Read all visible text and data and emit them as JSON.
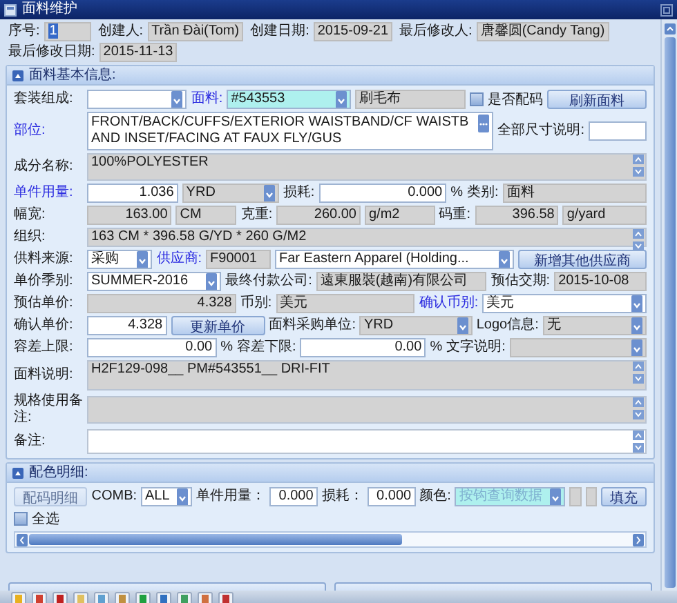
{
  "window": {
    "title": "面料维护"
  },
  "header_fields": [
    {
      "label": "序号:",
      "value": "1",
      "text_selected": true
    },
    {
      "label": "创建人:",
      "value": "Trần Đài(Tom)",
      "text_selected": false
    },
    {
      "label": "创建日期:",
      "value": "2015-09-21",
      "text_selected": false
    },
    {
      "label": "最后修改人:",
      "value": "唐馨圆(Candy Tang)",
      "text_selected": false
    },
    {
      "label": "最后修改日期:",
      "value": "2015-11-13",
      "text_selected": false
    }
  ],
  "basic_info": {
    "title": "面料基本信息:",
    "expanded": true,
    "rows": [
      {
        "items": [
          {
            "kind": "label",
            "text": "套装组成:",
            "required": false
          },
          {
            "kind": "dropdown",
            "readonly": false,
            "highlighted": false
          },
          {
            "kind": "label",
            "text": "面料:",
            "required": true
          },
          {
            "kind": "dropdown",
            "value": "#543553",
            "readonly": false,
            "highlighted": true
          },
          {
            "kind": "field",
            "value": "刷毛布",
            "readonly": true,
            "highlighted": false
          },
          {
            "kind": "checkbox",
            "text": "是否配码",
            "checked": false
          },
          {
            "kind": "button",
            "text": "刷新面料",
            "disabled": false
          }
        ]
      },
      {
        "items": [
          {
            "kind": "label",
            "text": "部位:",
            "required": true
          },
          {
            "kind": "browse",
            "value": "FRONT/BACK/CUFFS/EXTERIOR WAISTBAND/CF WAISTBAND INSET/FACING AT FAUX FLY/GUS",
            "readonly": false,
            "highlighted": false
          },
          {
            "kind": "label",
            "text": "全部尺寸说明:",
            "required": false
          },
          {
            "kind": "field",
            "readonly": false,
            "highlighted": false
          }
        ]
      },
      {
        "items": [
          {
            "kind": "label",
            "text": "成分名称:",
            "required": false
          },
          {
            "kind": "textarea",
            "value": "100%POLYESTER",
            "readonly": true,
            "highlighted": false
          }
        ]
      },
      {
        "items": [
          {
            "kind": "label",
            "text": "单件用量:",
            "required": true
          },
          {
            "kind": "number",
            "value": "1.036",
            "readonly": false,
            "highlighted": false
          },
          {
            "kind": "dropdown",
            "value": "YRD",
            "readonly": true,
            "highlighted": false
          },
          {
            "kind": "label",
            "text": "损耗:",
            "required": false
          },
          {
            "kind": "number",
            "value": "0.000",
            "readonly": false,
            "highlighted": false
          },
          {
            "kind": "unit",
            "text": "%"
          },
          {
            "kind": "label",
            "text": "类别:",
            "required": false
          },
          {
            "kind": "field",
            "value": "面料",
            "readonly": true,
            "highlighted": false
          }
        ]
      },
      {
        "items": [
          {
            "kind": "label",
            "text": "幅宽:",
            "required": false
          },
          {
            "kind": "number",
            "value": "163.00",
            "readonly": true,
            "highlighted": false
          },
          {
            "kind": "field",
            "value": "CM",
            "readonly": true,
            "highlighted": false
          },
          {
            "kind": "label",
            "text": "克重:",
            "required": false
          },
          {
            "kind": "number",
            "value": "260.00",
            "readonly": true,
            "highlighted": false
          },
          {
            "kind": "field",
            "value": "g/m2",
            "readonly": true,
            "highlighted": false
          },
          {
            "kind": "label",
            "text": "码重:",
            "required": false
          },
          {
            "kind": "number",
            "value": "396.58",
            "readonly": true,
            "highlighted": false
          },
          {
            "kind": "field",
            "value": "g/yard",
            "readonly": true,
            "highlighted": false
          }
        ]
      },
      {
        "items": [
          {
            "kind": "label",
            "text": "组织:",
            "required": false
          },
          {
            "kind": "textarea",
            "value": "163 CM * 396.58 G/YD * 260 G/M2",
            "readonly": true,
            "highlighted": false
          }
        ]
      },
      {
        "items": [
          {
            "kind": "label",
            "text": "供料来源:",
            "required": false
          },
          {
            "kind": "dropdown",
            "value": "采购",
            "readonly": false,
            "highlighted": false
          },
          {
            "kind": "label",
            "text": "供应商:",
            "required": true
          },
          {
            "kind": "field",
            "value": "F90001",
            "readonly": true,
            "highlighted": false
          },
          {
            "kind": "dropdown",
            "value": "Far Eastern Apparel (Holding...",
            "readonly": false,
            "highlighted": false
          },
          {
            "kind": "button",
            "text": "新增其他供应商",
            "disabled": false
          }
        ]
      },
      {
        "items": [
          {
            "kind": "label",
            "text": "单价季别:",
            "required": false
          },
          {
            "kind": "dropdown",
            "value": "SUMMER-2016",
            "readonly": false,
            "highlighted": false
          },
          {
            "kind": "label",
            "text": "最终付款公司:",
            "required": false
          },
          {
            "kind": "field",
            "value": "遠東服裝(越南)有限公司",
            "readonly": true,
            "highlighted": false
          },
          {
            "kind": "label",
            "text": "预估交期:",
            "required": false
          },
          {
            "kind": "field",
            "value": "2015-10-08",
            "readonly": true,
            "highlighted": false
          }
        ]
      },
      {
        "items": [
          {
            "kind": "label",
            "text": "预估单价:",
            "required": false
          },
          {
            "kind": "number",
            "value": "4.328",
            "readonly": true,
            "highlighted": false
          },
          {
            "kind": "label",
            "text": "币别:",
            "required": false
          },
          {
            "kind": "field",
            "value": "美元",
            "readonly": true,
            "highlighted": false
          },
          {
            "kind": "label",
            "text": "确认币别:",
            "required": true
          },
          {
            "kind": "dropdown",
            "value": "美元",
            "readonly": false,
            "highlighted": false
          }
        ]
      },
      {
        "items": [
          {
            "kind": "label",
            "text": "确认单价:",
            "required": false
          },
          {
            "kind": "number",
            "value": "4.328",
            "readonly": false,
            "highlighted": false
          },
          {
            "kind": "button",
            "text": "更新单价",
            "disabled": false
          },
          {
            "kind": "label",
            "text": "面料采购单位:",
            "required": false
          },
          {
            "kind": "dropdown",
            "value": "YRD",
            "readonly": true,
            "highlighted": false
          },
          {
            "kind": "label",
            "text": "Logo信息:",
            "required": false
          },
          {
            "kind": "dropdown",
            "value": "无",
            "readonly": true,
            "highlighted": false
          }
        ]
      },
      {
        "items": [
          {
            "kind": "label",
            "text": "容差上限:",
            "required": false
          },
          {
            "kind": "number",
            "value": "0.00",
            "readonly": false,
            "highlighted": false
          },
          {
            "kind": "unit",
            "text": "%"
          },
          {
            "kind": "label",
            "text": "容差下限:",
            "required": false
          },
          {
            "kind": "number",
            "value": "0.00",
            "readonly": false,
            "highlighted": false
          },
          {
            "kind": "unit",
            "text": "%"
          },
          {
            "kind": "label",
            "text": "文字说明:",
            "required": false
          },
          {
            "kind": "dropdown",
            "readonly": true,
            "highlighted": false
          }
        ]
      },
      {
        "items": [
          {
            "kind": "label",
            "text": "面料说明:",
            "required": false
          },
          {
            "kind": "textarea",
            "value": "H2F129-098__ PM#543551__ DRI-FIT",
            "readonly": true,
            "highlighted": false
          }
        ]
      },
      {
        "items": [
          {
            "kind": "label",
            "text": "规格使用备注:",
            "required": false
          },
          {
            "kind": "textarea",
            "readonly": true,
            "highlighted": false
          }
        ]
      },
      {
        "items": [
          {
            "kind": "label",
            "text": "备注:",
            "required": false
          },
          {
            "kind": "textarea",
            "readonly": false,
            "highlighted": false
          }
        ]
      }
    ]
  },
  "color_detail": {
    "title": "配色明细:",
    "expanded": true,
    "rows": [
      {
        "items": [
          {
            "kind": "button",
            "text": "配码明细",
            "disabled": true
          },
          {
            "kind": "label",
            "text": "COMB:",
            "required": false
          },
          {
            "kind": "dropdown",
            "value": "ALL",
            "readonly": false,
            "highlighted": false
          },
          {
            "kind": "label",
            "text": "单件用量：",
            "required": false
          },
          {
            "kind": "number",
            "value": "0.000",
            "readonly": false,
            "highlighted": false
          },
          {
            "kind": "label",
            "text": "损耗：",
            "required": false
          },
          {
            "kind": "number",
            "value": "0.000",
            "readonly": false,
            "highlighted": false
          },
          {
            "kind": "label",
            "text": "颜色:",
            "required": false
          },
          {
            "kind": "dropdown",
            "placeholder": "按钩查询数据",
            "readonly": false,
            "highlighted": true
          },
          {
            "kind": "field",
            "readonly": true,
            "highlighted": false
          },
          {
            "kind": "field",
            "readonly": true,
            "highlighted": false
          },
          {
            "kind": "button",
            "text": "填充",
            "disabled": false
          }
        ]
      },
      {
        "items": [
          {
            "kind": "checkbox",
            "text": "全选",
            "checked": false
          }
        ]
      }
    ]
  }
}
